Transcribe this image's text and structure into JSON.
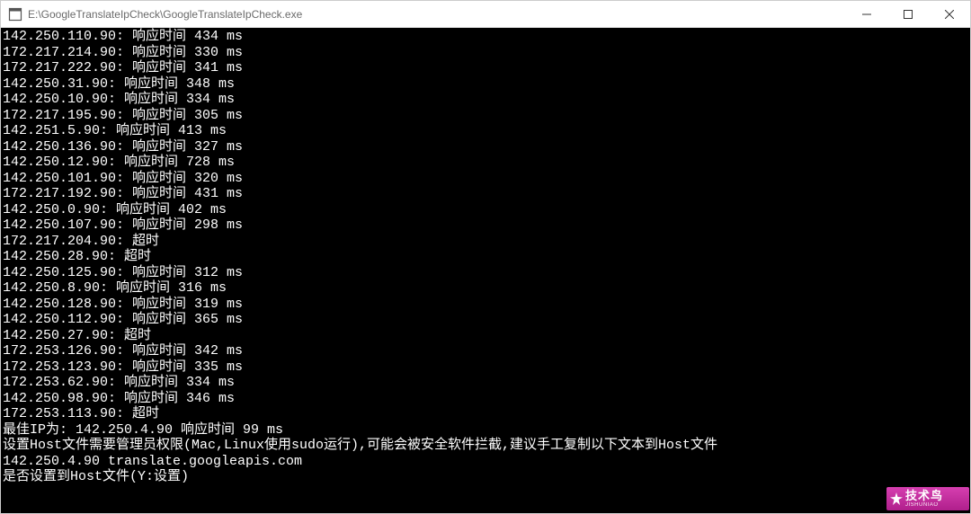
{
  "window": {
    "title": "E:\\GoogleTranslateIpCheck\\GoogleTranslateIpCheck.exe"
  },
  "response_label": "响应时间",
  "ms_label": "ms",
  "timeout_label": "超时",
  "results": [
    {
      "ip": "142.250.110.90",
      "ms": 434
    },
    {
      "ip": "172.217.214.90",
      "ms": 330
    },
    {
      "ip": "172.217.222.90",
      "ms": 341
    },
    {
      "ip": "142.250.31.90",
      "ms": 348
    },
    {
      "ip": "142.250.10.90",
      "ms": 334
    },
    {
      "ip": "172.217.195.90",
      "ms": 305
    },
    {
      "ip": "142.251.5.90",
      "ms": 413
    },
    {
      "ip": "142.250.136.90",
      "ms": 327
    },
    {
      "ip": "142.250.12.90",
      "ms": 728
    },
    {
      "ip": "142.250.101.90",
      "ms": 320
    },
    {
      "ip": "172.217.192.90",
      "ms": 431
    },
    {
      "ip": "142.250.0.90",
      "ms": 402
    },
    {
      "ip": "142.250.107.90",
      "ms": 298
    },
    {
      "ip": "172.217.204.90",
      "timeout": true
    },
    {
      "ip": "142.250.28.90",
      "timeout": true
    },
    {
      "ip": "142.250.125.90",
      "ms": 312
    },
    {
      "ip": "142.250.8.90",
      "ms": 316
    },
    {
      "ip": "142.250.128.90",
      "ms": 319
    },
    {
      "ip": "142.250.112.90",
      "ms": 365
    },
    {
      "ip": "142.250.27.90",
      "timeout": true
    },
    {
      "ip": "172.253.126.90",
      "ms": 342
    },
    {
      "ip": "172.253.123.90",
      "ms": 335
    },
    {
      "ip": "172.253.62.90",
      "ms": 334
    },
    {
      "ip": "142.250.98.90",
      "ms": 346
    },
    {
      "ip": "172.253.113.90",
      "timeout": true
    }
  ],
  "best": {
    "label": "最佳IP为:",
    "ip": "142.250.4.90",
    "ms": 99
  },
  "host_hint": "设置Host文件需要管理员权限(Mac,Linux使用sudo运行),可能会被安全软件拦截,建议手工复制以下文本到Host文件",
  "host_entry": "142.250.4.90 translate.googleapis.com",
  "prompt": "是否设置到Host文件(Y:设置)",
  "watermark": {
    "main": "技术鸟",
    "sub": "JISHUNIAO"
  }
}
